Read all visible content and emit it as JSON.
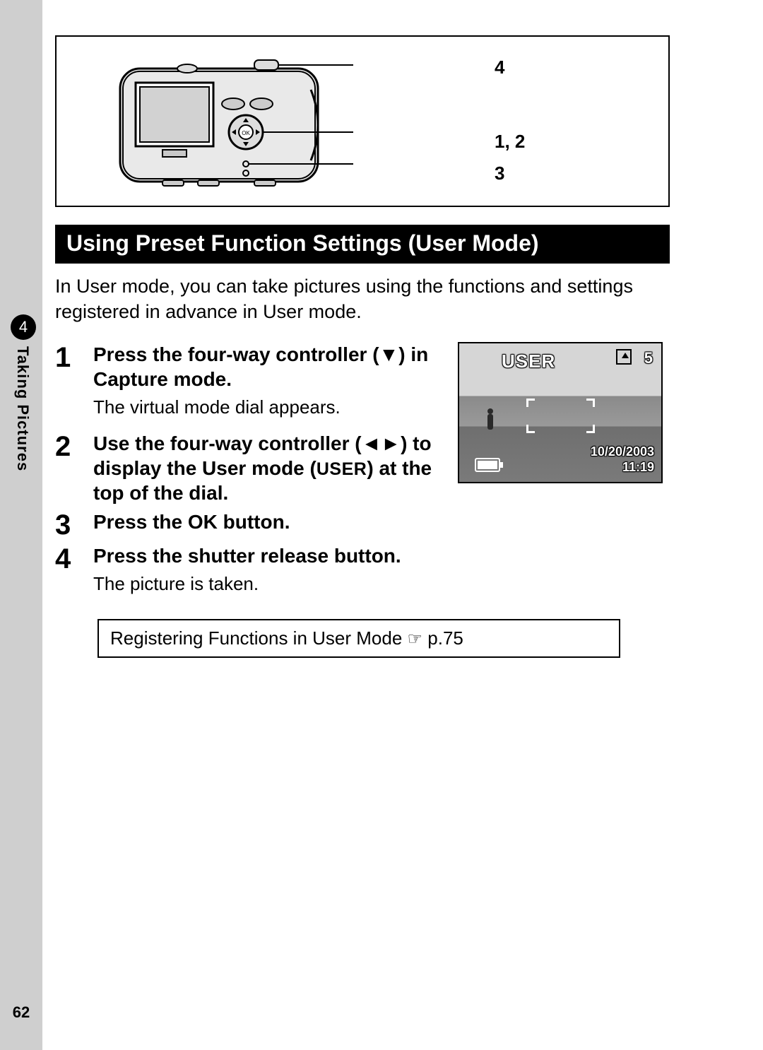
{
  "page_number": "62",
  "section_tab": {
    "number": "4",
    "label": "Taking Pictures"
  },
  "diagram_callouts": {
    "c4": "4",
    "c12": "1, 2",
    "c3": "3"
  },
  "section_title": "Using Preset Function Settings (User Mode)",
  "intro_text": "In User mode, you can take pictures using the functions and settings registered in advance in User mode.",
  "steps": [
    {
      "num": "1",
      "title_pre": "Press the four-way controller (",
      "title_post": ") in Capture mode.",
      "arrow": "▼",
      "sub": "The virtual mode dial appears."
    },
    {
      "num": "2",
      "title_pre": "Use the four-way controller (",
      "title_mid": ") to display the User mode (",
      "user_label": "USER",
      "title_post": ") at the top of the dial.",
      "arrow": "◄►"
    },
    {
      "num": "3",
      "title": "Press the OK button."
    },
    {
      "num": "4",
      "title": "Press the shutter release button.",
      "sub": "The picture is taken."
    }
  ],
  "screenshot": {
    "mode_label": "USER",
    "count": "5",
    "date": "10/20/2003",
    "time": "11:19"
  },
  "reference": {
    "text": "Registering Functions in User Mode ",
    "pointer": "☞",
    "page": " p.75"
  }
}
